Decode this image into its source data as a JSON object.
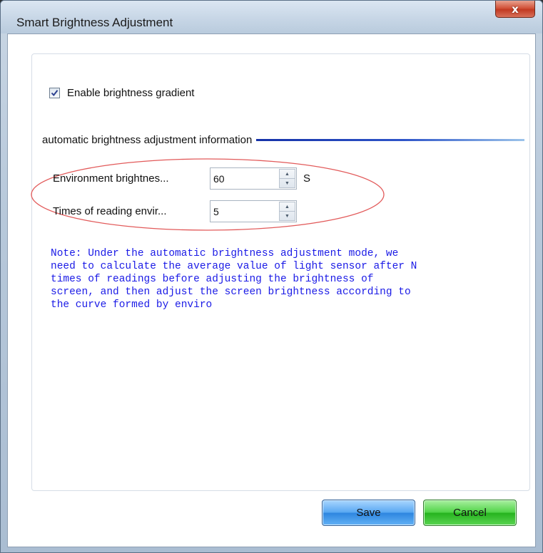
{
  "window": {
    "title": "Smart Brightness Adjustment",
    "close_glyph": "x"
  },
  "gradient": {
    "checked": true,
    "label": "Enable brightness gradient"
  },
  "section": {
    "title": "automatic brightness adjustment information"
  },
  "fields": [
    {
      "label": "Environment brightnes...",
      "value": "60",
      "unit": "S"
    },
    {
      "label": "Times of reading envir...",
      "value": "5",
      "unit": ""
    }
  ],
  "note": "Note: Under the automatic brightness adjustment mode, we\nneed to calculate the average value of light sensor after N\ntimes of readings before adjusting the brightness of\nscreen, and then adjust the screen brightness according to\nthe curve formed by enviro",
  "buttons": {
    "save": "Save",
    "cancel": "Cancel"
  },
  "colors": {
    "note_text": "#1a1ae6",
    "highlight_oval": "#e25a5a",
    "save_button": "#2e86e0",
    "cancel_button": "#26b31e",
    "close_button": "#c23a22"
  }
}
